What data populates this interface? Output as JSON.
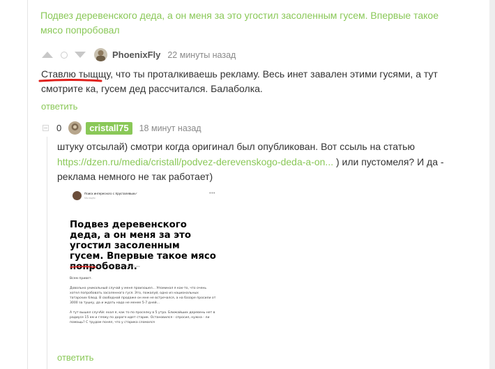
{
  "post": {
    "title": "Подвез деревенского деда, а он меня за это угостил засоленным гусем. Впервые такое мясо попробовал"
  },
  "comment1": {
    "author": "PhoenixFly",
    "time": "22 минуты назад",
    "text": "Ставлю тыщщу, что ты проталкиваешь рекламу. Весь инет завален этими гусями, а тут смотрите ка, гусем дед рассчитался. Балаболка.",
    "reply_label": "ответить"
  },
  "comment2": {
    "score": "0",
    "author": "cristall75",
    "time": "18 минут назад",
    "text_before": "штуку отсылай) смотри когда оригинал был опубликован. Вот ссыль на статью ",
    "link_text": "https://dzen.ru/media/cristall/podvez-derevenskogo-deda-a-on...",
    "text_after": " ) или пустомеля? И да - реклама немного не так работает)",
    "reply_label": "ответить"
  },
  "screenshot": {
    "channel": "Поиск интересного с Хрусталевым✓",
    "channel_sub": "Мы ищем",
    "title": "Подвез деревенского деда, а он меня за это угостил засоленным гусем. Впервые такое мясо попробовал.",
    "meta": "25.09.21 12:34   ⊡ 3 630   ⊙ 3 7/3 95 (1%)   ⊙ 1 мин 19 сек",
    "greeting": "Всем привет.",
    "p1": "Довольно уникальный случай у меня произошел... Упоминал я как-то, что очень хотел попробовать засоленного гуся. Это, пожалуй, одно из национальных татарских блюд. В свободной продаже он мне не встречался, а на базаре просили от 3000 за тушку, да и ждать надо не менее 5-7 дней...",
    "p2": "А тут вышел случАй: ехал я, как то по проселку в 5 утра. Ближайших деревень нет в радиусе 15 км и гляжу по дороге идет старик. Остановился - спросил, нужна - ли помощь? С трудом понял, что у старика сломался"
  },
  "colors": {
    "accent_green": "#8ac858",
    "underline_red": "#e0201b"
  }
}
